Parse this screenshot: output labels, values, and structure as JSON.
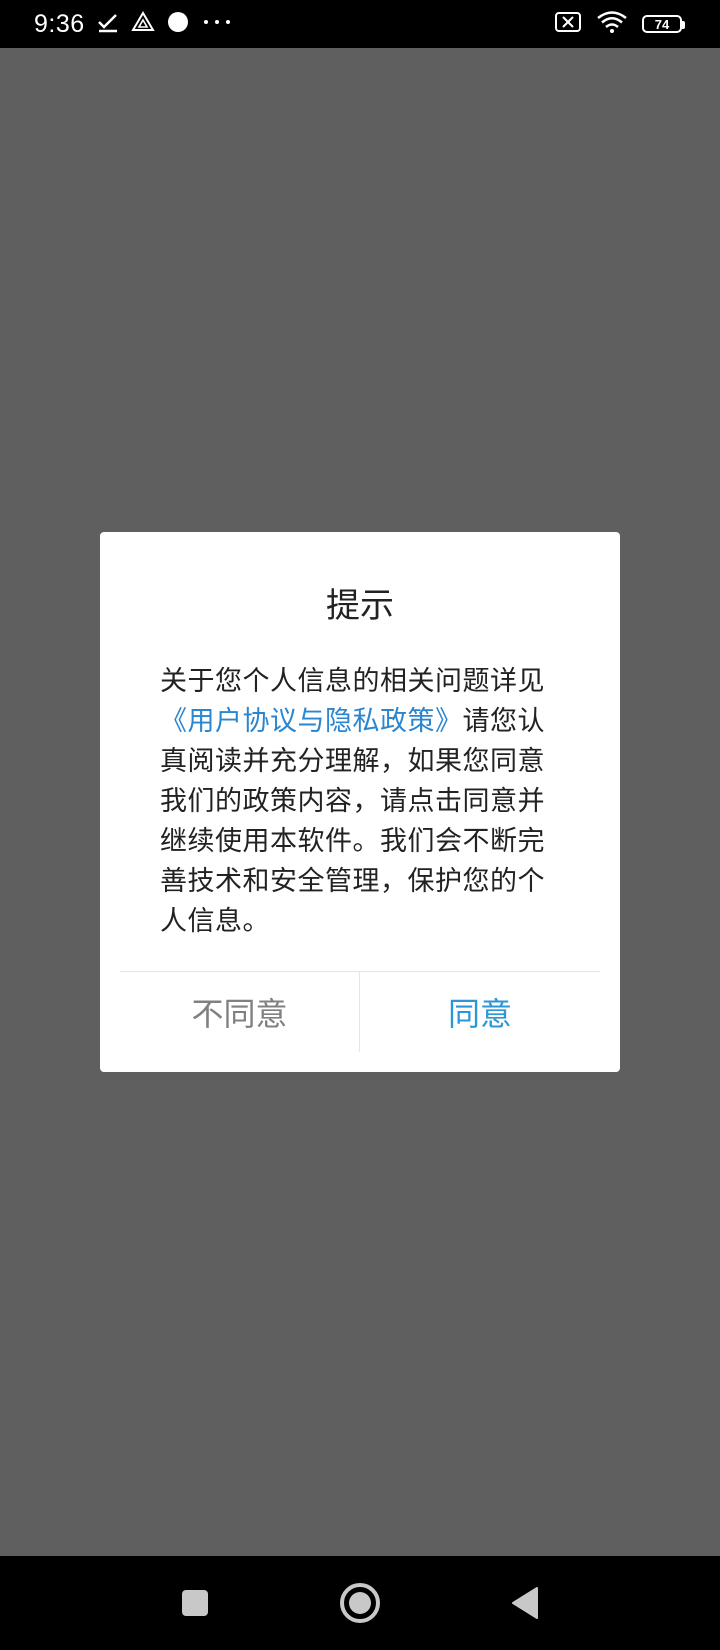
{
  "status_bar": {
    "time": "9:36",
    "battery_level": "74",
    "left_icons": [
      "check-icon",
      "drive-icon",
      "circle-icon",
      "more-icon"
    ],
    "right_icons": [
      "no-sim-icon",
      "wifi-icon",
      "battery-icon"
    ]
  },
  "dialog": {
    "title": "提示",
    "body_before_link": "关于您个人信息的相关问题详见",
    "link_text": "《用户协议与隐私政策》",
    "body_after_link": "请您认真阅读并充分理解，如果您同意我们的政策内容，请点击同意并继续使用本软件。我们会不断完善技术和安全管理，保护您的个人信息。",
    "disagree_label": "不同意",
    "agree_label": "同意"
  },
  "colors": {
    "overlay": "#5f5f5f",
    "link": "#2b86d1",
    "agree": "#2b97d6",
    "disagree": "#808080"
  },
  "nav_bar": {
    "items": [
      "recent-apps-icon",
      "home-icon",
      "back-icon"
    ]
  }
}
